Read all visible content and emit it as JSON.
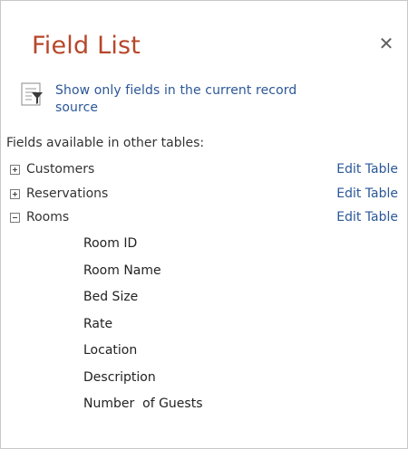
{
  "panel": {
    "title": "Field List",
    "close_glyph": "✕",
    "show_only_label": "Show only fields in the current record source",
    "show_only_line1": "Show only fields in the current record",
    "show_only_line2": "source",
    "show_only_icon": "filter-record-source-icon",
    "section_label": "Fields available in other tables:"
  },
  "tables": [
    {
      "name": "Customers",
      "expanded": false,
      "edit_label": "Edit Table"
    },
    {
      "name": "Reservations",
      "expanded": false,
      "edit_label": "Edit Table"
    },
    {
      "name": "Rooms",
      "expanded": true,
      "edit_label": "Edit Table"
    }
  ],
  "rooms_fields": [
    "Room ID",
    "Room Name",
    "Bed Size",
    "Rate",
    "Location",
    "Description",
    "Number  of Guests"
  ],
  "colors": {
    "title": "#b7472a",
    "link": "#2b5797",
    "text": "#333333"
  }
}
